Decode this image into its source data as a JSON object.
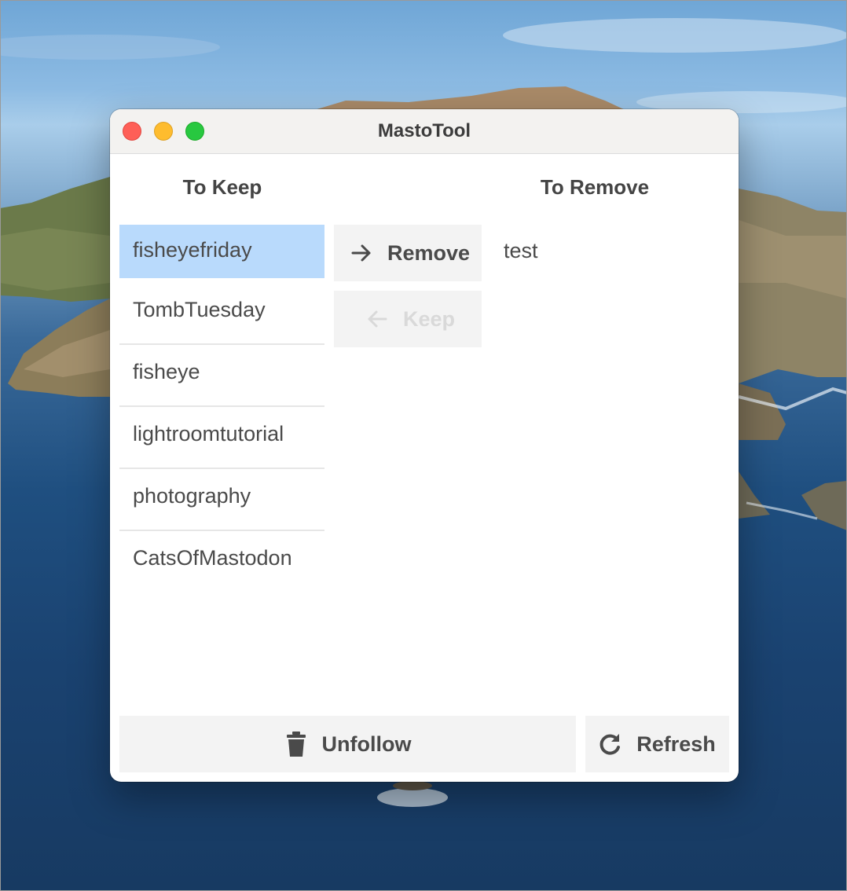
{
  "window": {
    "title": "MastoTool"
  },
  "columns": {
    "keep_heading": "To Keep",
    "remove_heading": "To Remove"
  },
  "keep_list": {
    "items": [
      {
        "label": "fisheyefriday",
        "selected": true
      },
      {
        "label": "TombTuesday",
        "selected": false
      },
      {
        "label": "fisheye",
        "selected": false
      },
      {
        "label": "lightroomtutorial",
        "selected": false
      },
      {
        "label": "photography",
        "selected": false
      },
      {
        "label": "CatsOfMastodon",
        "selected": false
      }
    ]
  },
  "remove_list": {
    "items": [
      {
        "label": "test"
      }
    ]
  },
  "actions": {
    "remove_label": "Remove",
    "remove_icon": "arrow-right-icon",
    "keep_label": "Keep",
    "keep_icon": "arrow-left-icon",
    "keep_enabled": false
  },
  "footer": {
    "unfollow_label": "Unfollow",
    "unfollow_icon": "trash-icon",
    "refresh_label": "Refresh",
    "refresh_icon": "refresh-icon"
  },
  "colors": {
    "selection": "#b9dafc",
    "close": "#fe5f57",
    "minimize": "#febc2e",
    "maximize": "#28c840"
  }
}
